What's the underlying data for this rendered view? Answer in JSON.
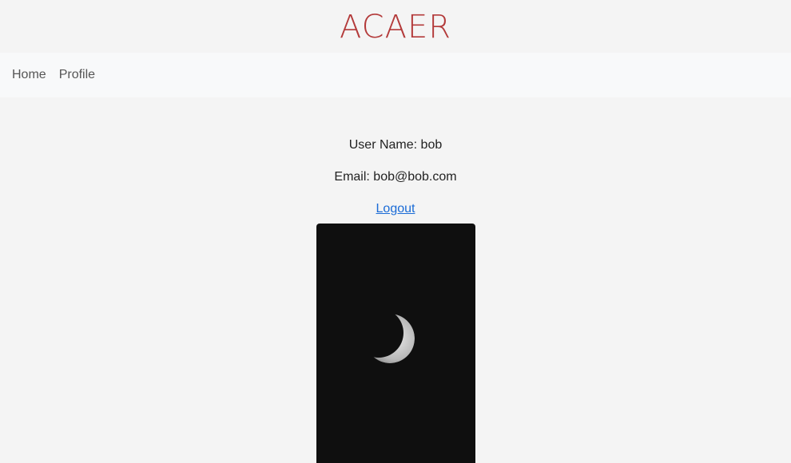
{
  "brand": {
    "name": "ACAER"
  },
  "nav": {
    "items": [
      {
        "label": "Home"
      },
      {
        "label": "Profile"
      }
    ]
  },
  "profile": {
    "username_line": "User Name: bob",
    "email_line": "Email: bob@bob.com",
    "logout_label": "Logout",
    "photo_icon": "crescent-moon-icon"
  },
  "colors": {
    "brand": "#b33a3a",
    "link": "#1a6bd6",
    "page_bg": "#f4f4f4",
    "navbar_bg": "#f8f9fa",
    "photo_bg": "#0f0f0f"
  }
}
